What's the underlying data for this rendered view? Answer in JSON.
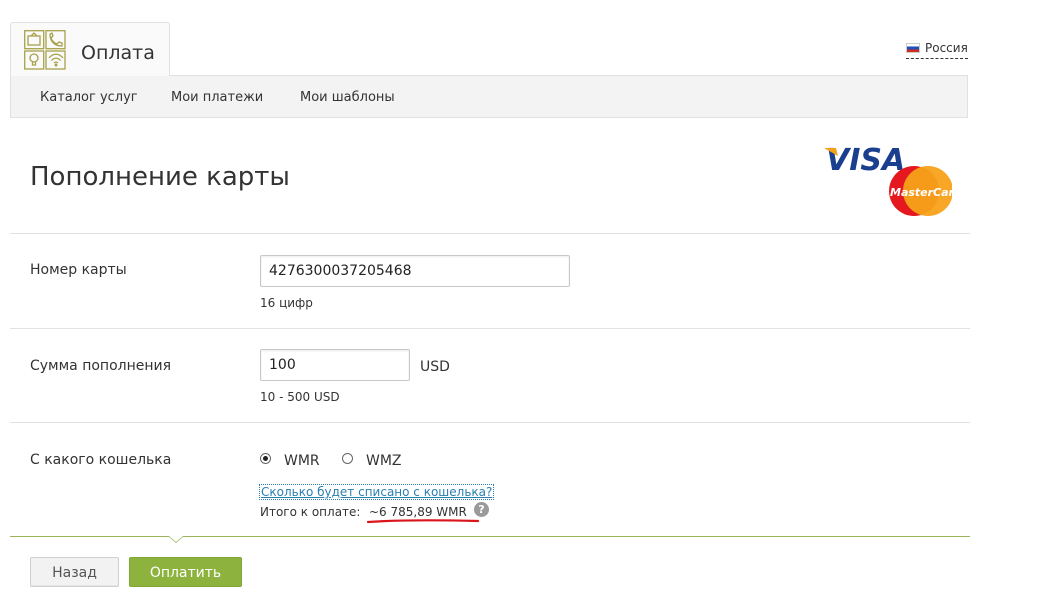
{
  "header": {
    "tab_title": "Оплата",
    "logo_icons": [
      "tv-icon",
      "phone-icon",
      "lightbulb-icon",
      "wifi-icon"
    ],
    "region": "Россия"
  },
  "nav": {
    "items": [
      {
        "label": "Каталог услуг"
      },
      {
        "label": "Мои платежи"
      },
      {
        "label": "Мои шаблоны"
      }
    ]
  },
  "page": {
    "title": "Пополнение карты",
    "card_brands": [
      "VISA",
      "MasterCard"
    ]
  },
  "form": {
    "card_number": {
      "label": "Номер карты",
      "value": "4276300037205468",
      "hint": "16 цифр"
    },
    "amount": {
      "label": "Сумма пополнения",
      "value": "100",
      "currency": "USD",
      "hint": "10 - 500 USD"
    },
    "wallet": {
      "label": "С какого кошелька",
      "options": [
        {
          "label": "WMR",
          "checked": true
        },
        {
          "label": "WMZ",
          "checked": false
        }
      ],
      "link": "Сколько будет списано с кошелька?",
      "total_label": "Итого к оплате:",
      "total_value": "~6 785,89 WMR",
      "help": "?"
    }
  },
  "buttons": {
    "back": "Назад",
    "pay": "Оплатить"
  },
  "colors": {
    "accent_green": "#8db33e",
    "link_blue": "#2a7fb0",
    "highlight_red": "#d9141b"
  }
}
